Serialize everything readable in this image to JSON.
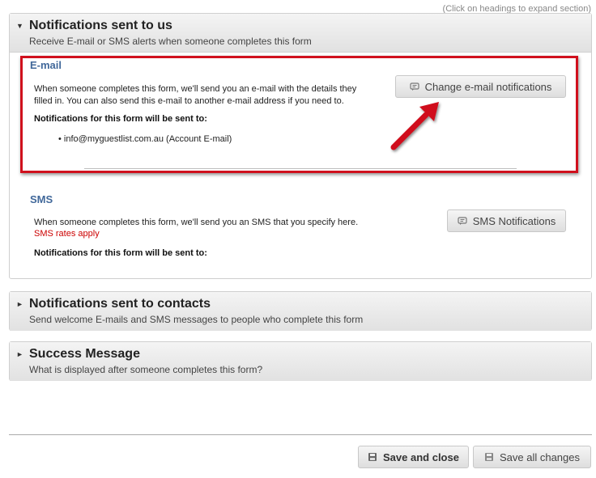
{
  "hint": "(Click on headings to expand section)",
  "sections": {
    "us": {
      "title": "Notifications sent to us",
      "subtitle": "Receive E-mail or SMS alerts when someone completes this form",
      "expanded": true
    },
    "contacts": {
      "title": "Notifications sent to contacts",
      "subtitle": "Send welcome E-mails and SMS messages to people who complete this form",
      "expanded": false
    },
    "success": {
      "title": "Success Message",
      "subtitle": "What is displayed after someone completes this form?",
      "expanded": false
    }
  },
  "email": {
    "title": "E-mail",
    "desc_line1": "When someone completes this form, we'll send you an e-mail with the details they",
    "desc_line2": "filled in. You can also send this e-mail to another e-mail address if you need to.",
    "sent_to_label": "Notifications for this form will be sent to:",
    "recipients": [
      "info@myguestlist.com.au (Account E-mail)"
    ],
    "button": "Change e-mail notifications"
  },
  "sms": {
    "title": "SMS",
    "desc": "When someone completes this form, we'll send you an SMS that you specify here.",
    "rates": "SMS rates apply",
    "sent_to_label": "Notifications for this form will be sent to:",
    "button": "SMS Notifications"
  },
  "footer": {
    "save_close": "Save and close",
    "save_all": "Save all changes"
  },
  "colors": {
    "highlight": "#d0101d",
    "subtitle_blue": "#41689a",
    "rates_red": "#cc0000"
  }
}
